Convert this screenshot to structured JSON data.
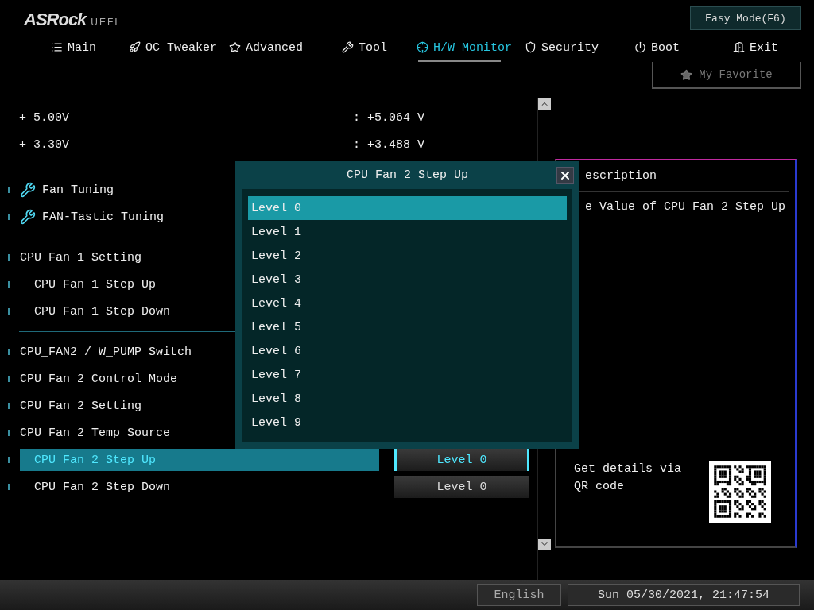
{
  "logo": {
    "brand": "ASRock",
    "suffix": "UEFI"
  },
  "easy_mode": "Easy Mode(F6)",
  "tabs": [
    {
      "label": "Main",
      "selected": false
    },
    {
      "label": "OC Tweaker",
      "selected": false
    },
    {
      "label": "Advanced",
      "selected": false
    },
    {
      "label": "Tool",
      "selected": false
    },
    {
      "label": "H/W Monitor",
      "selected": true
    },
    {
      "label": "Security",
      "selected": false
    },
    {
      "label": "Boot",
      "selected": false
    },
    {
      "label": "Exit",
      "selected": false
    }
  ],
  "favorite": "My Favorite",
  "sections": [
    {
      "items": [
        {
          "kind": "reading",
          "label": "+ 5.00V",
          "value": ": +5.064 V"
        },
        {
          "kind": "reading",
          "label": "+ 3.30V",
          "value": ": +3.488 V"
        }
      ]
    },
    {
      "items": [
        {
          "kind": "tool",
          "label": "Fan Tuning"
        },
        {
          "kind": "tool",
          "label": "FAN-Tastic Tuning"
        }
      ]
    },
    {
      "items": [
        {
          "kind": "setting",
          "label": "CPU Fan 1 Setting",
          "sub": false,
          "selected": false
        },
        {
          "kind": "setting",
          "label": "CPU Fan 1 Step Up",
          "sub": true,
          "selected": false
        },
        {
          "kind": "setting",
          "label": "CPU Fan 1 Step Down",
          "sub": true,
          "selected": false
        }
      ]
    },
    {
      "items": [
        {
          "kind": "setting",
          "label": "CPU_FAN2 / W_PUMP Switch",
          "sub": false,
          "selected": false
        },
        {
          "kind": "setting",
          "label": "CPU Fan 2 Control Mode",
          "sub": false,
          "selected": false
        },
        {
          "kind": "setting",
          "label": "CPU Fan 2 Setting",
          "sub": false,
          "selected": false
        },
        {
          "kind": "setting",
          "label": "CPU Fan 2 Temp Source",
          "sub": false,
          "selected": false
        },
        {
          "kind": "setting",
          "label": "CPU Fan 2 Step Up",
          "sub": true,
          "selected": true,
          "value": "Level 0"
        },
        {
          "kind": "setting",
          "label": "CPU Fan 2 Step Down",
          "sub": true,
          "selected": false,
          "value": "Level 0"
        }
      ]
    }
  ],
  "dialog": {
    "title": "CPU Fan 2 Step Up",
    "options": [
      {
        "label": "Level 0",
        "selected": true
      },
      {
        "label": "Level 1",
        "selected": false
      },
      {
        "label": "Level 2",
        "selected": false
      },
      {
        "label": "Level 3",
        "selected": false
      },
      {
        "label": "Level 4",
        "selected": false
      },
      {
        "label": "Level 5",
        "selected": false
      },
      {
        "label": "Level 6",
        "selected": false
      },
      {
        "label": "Level 7",
        "selected": false
      },
      {
        "label": "Level 8",
        "selected": false
      },
      {
        "label": "Level 9",
        "selected": false
      }
    ]
  },
  "description": {
    "heading": "escription",
    "text": "e Value of CPU Fan 2 Step Up",
    "qr_caption": "Get details via QR code"
  },
  "footer": {
    "language": "English",
    "datetime": "Sun 05/30/2021, 21:47:54"
  }
}
